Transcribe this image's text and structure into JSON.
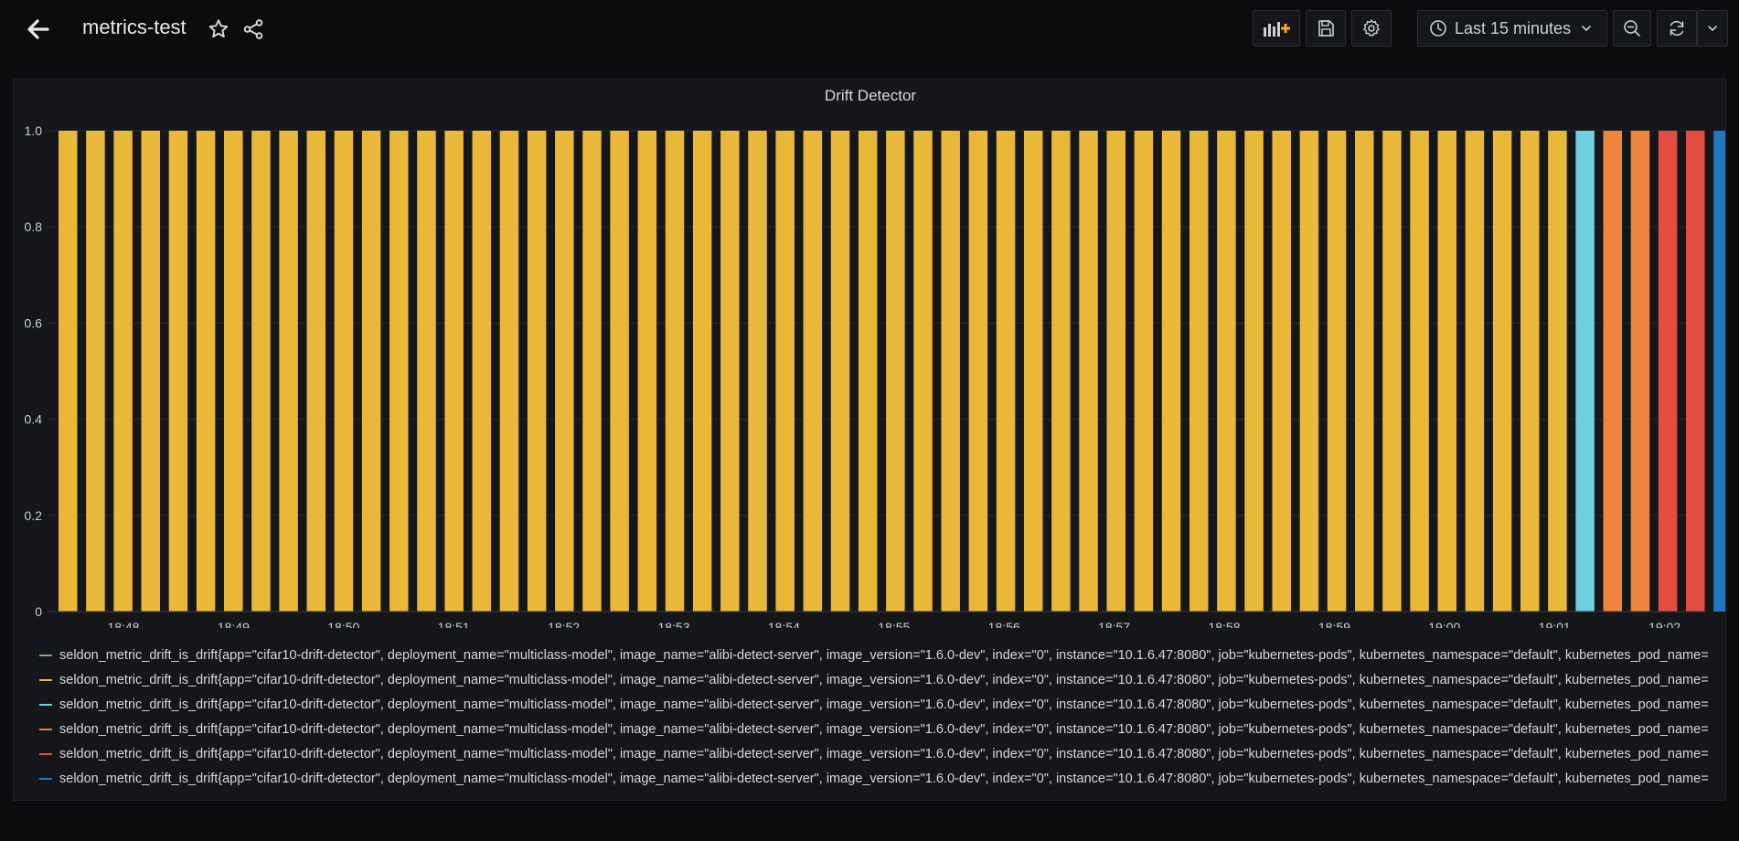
{
  "header": {
    "dashboard_title": "metrics-test",
    "time_range_label": "Last 15 minutes",
    "icons": {
      "back": "arrow-left-icon",
      "star": "star-icon",
      "share": "share-icon",
      "add_panel": "add-panel-icon",
      "save": "save-icon",
      "settings": "gear-icon",
      "time": "clock-icon",
      "zoom_out": "zoom-out-icon",
      "refresh": "refresh-icon",
      "refresh_menu": "chevron-down-icon"
    }
  },
  "panel": {
    "title": "Drift Detector"
  },
  "chart_data": {
    "type": "bar",
    "title": "Drift Detector",
    "ylim": [
      0,
      1
    ],
    "y_ticks": [
      "0",
      "0.2",
      "0.4",
      "0.6",
      "0.8",
      "1.0"
    ],
    "x_ticks": [
      "18:48",
      "18:49",
      "18:50",
      "18:51",
      "18:52",
      "18:53",
      "18:54",
      "18:55",
      "18:56",
      "18:57",
      "18:58",
      "18:59",
      "19:00",
      "19:01",
      "19:02"
    ],
    "grid": true,
    "legend_placement": "bottom",
    "series": [
      {
        "name": "seldon_metric_drift_is_drift{app=\"cifar10-drift-detector\", deployment_name=\"multiclass-model\", image_name=\"alibi-detect-server\", image_version=\"1.6.0-dev\", index=\"0\", instance=\"10.1.6.47:8080\", job=\"kubernetes-pods\", kubernetes_namespace=\"default\", kubernetes_pod_name=",
        "color": "#7eb26d"
      },
      {
        "name": "seldon_metric_drift_is_drift{app=\"cifar10-drift-detector\", deployment_name=\"multiclass-model\", image_name=\"alibi-detect-server\", image_version=\"1.6.0-dev\", index=\"0\", instance=\"10.1.6.47:8080\", job=\"kubernetes-pods\", kubernetes_namespace=\"default\", kubernetes_pod_name=",
        "color": "#eab839"
      },
      {
        "name": "seldon_metric_drift_is_drift{app=\"cifar10-drift-detector\", deployment_name=\"multiclass-model\", image_name=\"alibi-detect-server\", image_version=\"1.6.0-dev\", index=\"0\", instance=\"10.1.6.47:8080\", job=\"kubernetes-pods\", kubernetes_namespace=\"default\", kubernetes_pod_name=",
        "color": "#6ed0e0"
      },
      {
        "name": "seldon_metric_drift_is_drift{app=\"cifar10-drift-detector\", deployment_name=\"multiclass-model\", image_name=\"alibi-detect-server\", image_version=\"1.6.0-dev\", index=\"0\", instance=\"10.1.6.47:8080\", job=\"kubernetes-pods\", kubernetes_namespace=\"default\", kubernetes_pod_name=",
        "color": "#ef843c"
      },
      {
        "name": "seldon_metric_drift_is_drift{app=\"cifar10-drift-detector\", deployment_name=\"multiclass-model\", image_name=\"alibi-detect-server\", image_version=\"1.6.0-dev\", index=\"0\", instance=\"10.1.6.47:8080\", job=\"kubernetes-pods\", kubernetes_namespace=\"default\", kubernetes_pod_name=",
        "color": "#e24d42"
      },
      {
        "name": "seldon_metric_drift_is_drift{app=\"cifar10-drift-detector\", deployment_name=\"multiclass-model\", image_name=\"alibi-detect-server\", image_version=\"1.6.0-dev\", index=\"0\", instance=\"10.1.6.47:8080\", job=\"kubernetes-pods\", kubernetes_namespace=\"default\", kubernetes_pod_name=",
        "color": "#1f78c1"
      }
    ],
    "bars": [
      {
        "series": 1,
        "value": 1
      },
      {
        "series": 1,
        "value": 1
      },
      {
        "series": 1,
        "value": 1
      },
      {
        "series": 1,
        "value": 1
      },
      {
        "series": 1,
        "value": 1
      },
      {
        "series": 1,
        "value": 1
      },
      {
        "series": 1,
        "value": 1
      },
      {
        "series": 1,
        "value": 1
      },
      {
        "series": 1,
        "value": 1
      },
      {
        "series": 1,
        "value": 1
      },
      {
        "series": 1,
        "value": 1
      },
      {
        "series": 1,
        "value": 1
      },
      {
        "series": 1,
        "value": 1
      },
      {
        "series": 1,
        "value": 1
      },
      {
        "series": 1,
        "value": 1
      },
      {
        "series": 1,
        "value": 1
      },
      {
        "series": 1,
        "value": 1
      },
      {
        "series": 1,
        "value": 1
      },
      {
        "series": 1,
        "value": 1
      },
      {
        "series": 1,
        "value": 1
      },
      {
        "series": 1,
        "value": 1
      },
      {
        "series": 1,
        "value": 1
      },
      {
        "series": 1,
        "value": 1
      },
      {
        "series": 1,
        "value": 1
      },
      {
        "series": 1,
        "value": 1
      },
      {
        "series": 1,
        "value": 1
      },
      {
        "series": 1,
        "value": 1
      },
      {
        "series": 1,
        "value": 1
      },
      {
        "series": 1,
        "value": 1
      },
      {
        "series": 1,
        "value": 1
      },
      {
        "series": 1,
        "value": 1
      },
      {
        "series": 1,
        "value": 1
      },
      {
        "series": 1,
        "value": 1
      },
      {
        "series": 1,
        "value": 1
      },
      {
        "series": 1,
        "value": 1
      },
      {
        "series": 1,
        "value": 1
      },
      {
        "series": 1,
        "value": 1
      },
      {
        "series": 1,
        "value": 1
      },
      {
        "series": 1,
        "value": 1
      },
      {
        "series": 1,
        "value": 1
      },
      {
        "series": 1,
        "value": 1
      },
      {
        "series": 1,
        "value": 1
      },
      {
        "series": 1,
        "value": 1
      },
      {
        "series": 1,
        "value": 1
      },
      {
        "series": 1,
        "value": 1
      },
      {
        "series": 1,
        "value": 1
      },
      {
        "series": 1,
        "value": 1
      },
      {
        "series": 1,
        "value": 1
      },
      {
        "series": 1,
        "value": 1
      },
      {
        "series": 1,
        "value": 1
      },
      {
        "series": 1,
        "value": 1
      },
      {
        "series": 1,
        "value": 1
      },
      {
        "series": 1,
        "value": 1
      },
      {
        "series": 1,
        "value": 1
      },
      {
        "series": 1,
        "value": 1
      },
      {
        "series": 2,
        "value": 1
      },
      {
        "series": 3,
        "value": 1
      },
      {
        "series": 3,
        "value": 1
      },
      {
        "series": 4,
        "value": 1
      },
      {
        "series": 4,
        "value": 1
      },
      {
        "series": 5,
        "value": 1
      },
      {
        "series": 5,
        "value": 1
      }
    ]
  }
}
